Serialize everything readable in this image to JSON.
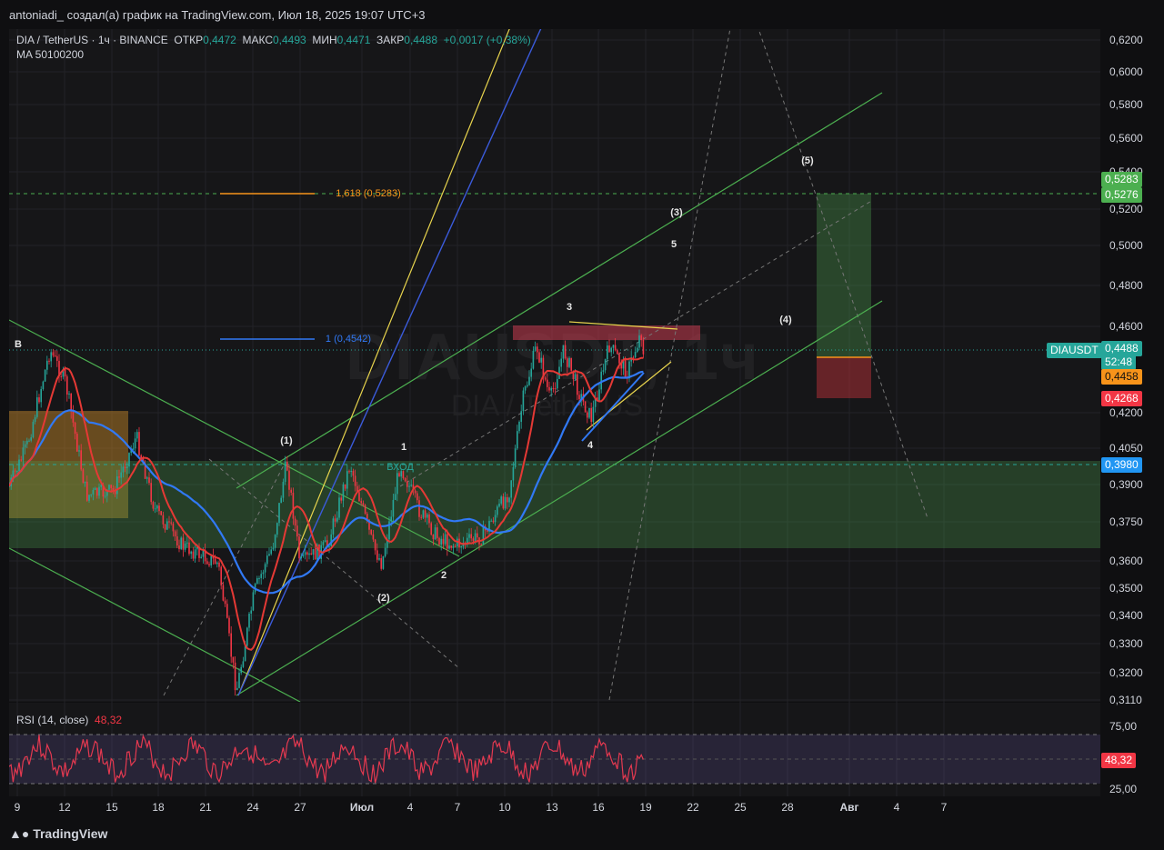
{
  "window": {
    "title": "antoniadi_ создал(а) график на TradingView.com, Июл 18, 2025 19:07 UTC+3"
  },
  "legend": {
    "symbol": "DIA / TetherUS · 1ч · BINANCE",
    "open_label": "ОТКР",
    "open": "0,4472",
    "high_label": "МАКС",
    "high": "0,4493",
    "low_label": "МИН",
    "low": "0,4471",
    "close_label": "ЗАКР",
    "close": "0,4488",
    "change": "+0,0017 (+0,38%)",
    "ma": "MA 50100200"
  },
  "watermark": {
    "main": "DIAUSDT, 1ч",
    "sub": "DIA / TetherUS"
  },
  "rsi": {
    "label": "RSI (14, close)",
    "value": "48,32",
    "ticks": [
      "75,00",
      "25,00"
    ]
  },
  "colors": {
    "up": "#26a69a",
    "down": "#f23645",
    "ma_fast": "#f23645",
    "ma_slow": "#3179f5",
    "fib": "#f7931a",
    "channel": "#4caf50"
  },
  "axis": {
    "price_ticks": [
      "0,6200",
      "0,6000",
      "0,5800",
      "0,5600",
      "0,5400",
      "0,5200",
      "0,5000",
      "0,4800",
      "0,4600",
      "0,4200",
      "0,4050",
      "0,3900",
      "0,3750",
      "0,3600",
      "0,3500",
      "0,3400",
      "0,3300",
      "0,3200",
      "0,3110"
    ],
    "time_ticks": [
      "9",
      "12",
      "15",
      "18",
      "21",
      "24",
      "27",
      "Июл",
      "4",
      "7",
      "10",
      "13",
      "16",
      "19",
      "22",
      "25",
      "28",
      "Авг",
      "4",
      "7"
    ]
  },
  "badges": {
    "target_hi": "0,5283",
    "target_lo": "0,5276",
    "symbol": "DIAUSDT",
    "last": "0,4488",
    "countdown": "52:48",
    "entry_level": "0,4458",
    "stop": "0,4268",
    "zone": "0,3980",
    "rsi_value": "48,32"
  },
  "annotations": {
    "fib_1618": "1,618 (0,5283)",
    "fib_1": "1 (0,4542)",
    "entry": "ВХОД",
    "b": "B",
    "waves": [
      "(1)",
      "(2)",
      "(3)",
      "(4)",
      "(5)",
      "1",
      "2",
      "3",
      "4",
      "5"
    ]
  },
  "footer": {
    "brand": "TradingView"
  },
  "chart_data": {
    "type": "line",
    "title": "DIA / TetherUS · 1ч · BINANCE",
    "xlabel": "",
    "ylabel": "",
    "ylim": [
      0.311,
      0.62
    ],
    "x": [
      "9",
      "12",
      "15",
      "18",
      "21",
      "24",
      "27",
      "Июл",
      "4",
      "7",
      "10",
      "13",
      "16",
      "19"
    ],
    "series": [
      {
        "name": "",
        "values": [
          0.395,
          0.44,
          0.392,
          0.385,
          0.37,
          0.316,
          0.375,
          0.386,
          0.395,
          0.378,
          0.382,
          0.445,
          0.445,
          0.4488
        ]
      }
    ],
    "levels": [
      0.5283,
      0.5276,
      0.4542,
      0.4458,
      0.4268,
      0.398
    ],
    "legend": "none",
    "grid": true
  }
}
